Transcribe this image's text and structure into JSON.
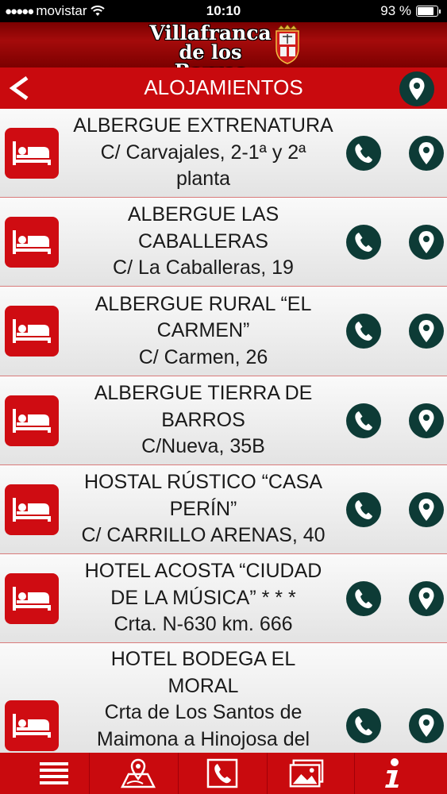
{
  "status_bar": {
    "carrier": "movistar",
    "time": "10:10",
    "battery": "93 %",
    "battery_level": 0.93
  },
  "brand": {
    "line1": "Villafranca",
    "line2": "de los Barros"
  },
  "header": {
    "title": "ALOJAMIENTOS"
  },
  "accommodations": [
    {
      "name_lines": [
        "ALBERGUE EXTRENATURA"
      ],
      "address_lines": [
        "C/ Carvajales, 2-1ª y 2ª",
        "planta"
      ]
    },
    {
      "name_lines": [
        "ALBERGUE LAS",
        "CABALLERAS"
      ],
      "address_lines": [
        "C/  La Caballeras, 19"
      ]
    },
    {
      "name_lines": [
        "ALBERGUE RURAL “EL",
        "CARMEN”"
      ],
      "address_lines": [
        "C/ Carmen, 26"
      ]
    },
    {
      "name_lines": [
        "ALBERGUE TIERRA DE",
        "BARROS"
      ],
      "address_lines": [
        "C/Nueva, 35B"
      ]
    },
    {
      "name_lines": [
        "HOSTAL RÚSTICO “CASA",
        "PERÍN”"
      ],
      "address_lines": [
        "C/ CARRILLO ARENAS, 40"
      ]
    },
    {
      "name_lines": [
        "HOTEL ACOSTA “CIUDAD",
        "DE LA MÚSICA” * * *"
      ],
      "address_lines": [
        "Crta. N-630 km. 666"
      ]
    },
    {
      "name_lines": [
        "HOTEL BODEGA EL",
        "MORAL"
      ],
      "address_lines": [
        "Crta de Los Santos de",
        "Maimona a Hinojosa del"
      ]
    }
  ],
  "icons": {
    "back": "back-arrow-icon",
    "map": "map-pin-icon",
    "bed": "bed-icon",
    "phone": "phone-icon",
    "tabs": [
      "menu-icon",
      "map-route-icon",
      "phone-icon",
      "gallery-icon",
      "info-icon"
    ]
  },
  "colors": {
    "primary_red": "#c90a0e",
    "dark_green": "#0d3b36"
  }
}
